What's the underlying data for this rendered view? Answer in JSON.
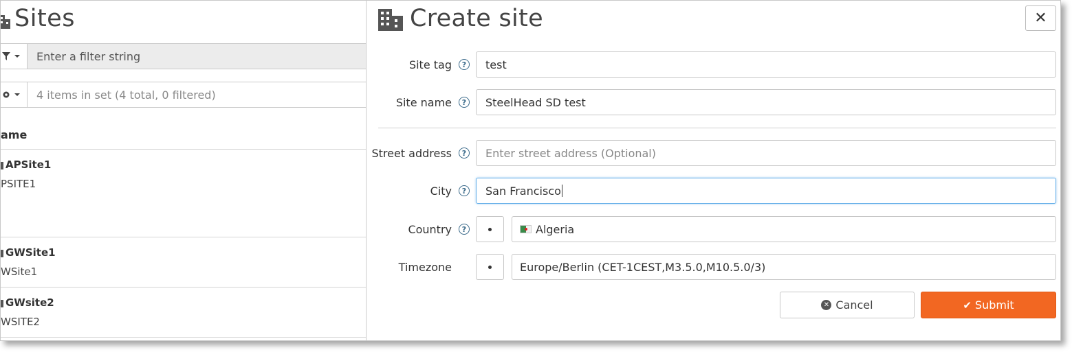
{
  "colors": {
    "accent": "#f26722",
    "focus": "#66afe9",
    "help": "#3a6a8a"
  },
  "sites_panel": {
    "title": "Sites",
    "filter_placeholder": "Enter a filter string",
    "items_info": "4 items in set (4 total, 0 filtered)",
    "column_header": "ame",
    "rows": [
      {
        "name": "APSite1",
        "sub": "PSITE1"
      },
      {
        "name": "GWSite1",
        "sub": "WSite1"
      },
      {
        "name": "GWsite2",
        "sub": "WSITE2"
      }
    ]
  },
  "modal": {
    "title": "Create site",
    "close_label": "✕",
    "fields": {
      "site_tag": {
        "label": "Site tag",
        "value": "test"
      },
      "site_name": {
        "label": "Site name",
        "value": "SteelHead SD test"
      },
      "street": {
        "label": "Street address",
        "placeholder": "Enter street address (Optional)"
      },
      "city": {
        "label": "City",
        "value": "San Francisco"
      },
      "country": {
        "label": "Country",
        "value": "Algeria"
      },
      "timezone": {
        "label": "Timezone",
        "value": "Europe/Berlin (CET-1CEST,M3.5.0,M10.5.0/3)"
      }
    },
    "help_glyph": "?",
    "cancel_label": "Cancel",
    "submit_label": "Submit"
  }
}
